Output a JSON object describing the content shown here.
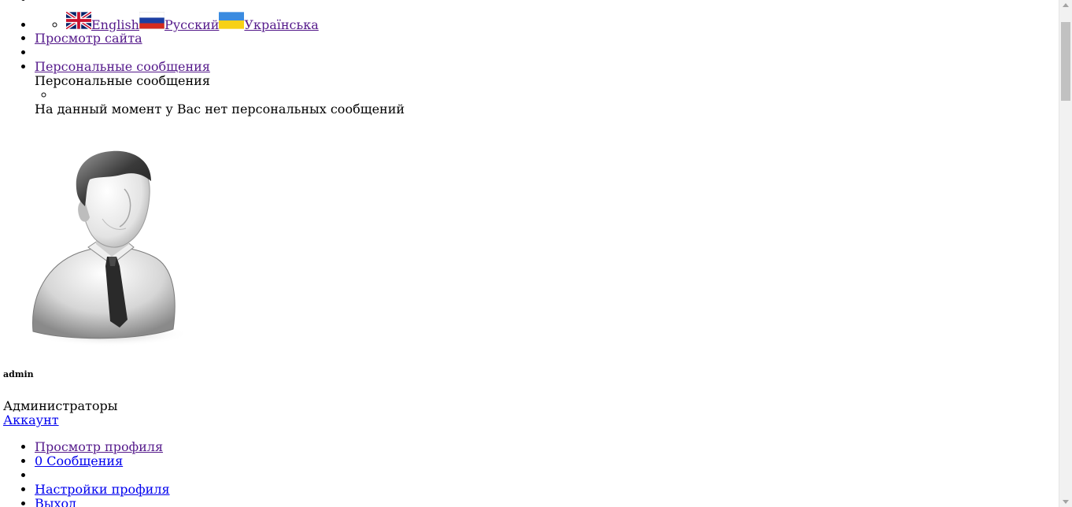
{
  "languages": [
    {
      "label": "English",
      "flag": "uk-flag-icon"
    },
    {
      "label": "Русский",
      "flag": "ru-flag-icon"
    },
    {
      "label": "Українська",
      "flag": "ua-flag-icon"
    }
  ],
  "nav": {
    "view_site": "Просмотр сайта",
    "personal_messages_link": "Персональные сообщения"
  },
  "messages": {
    "title": "Персональные сообщения",
    "empty": "На данный момент у Вас нет персональных сообщений"
  },
  "user": {
    "avatar": "user-avatar-icon",
    "name": "admin",
    "role": "Администраторы",
    "account_link": "Аккаунт"
  },
  "profile_menu": {
    "view_profile": "Просмотр профиля",
    "messages": "0 Сообщения",
    "settings": "Настройки профиля",
    "logout": "Выход"
  },
  "colors": {
    "visited_link": "#551a8b",
    "link": "#0000ee"
  }
}
